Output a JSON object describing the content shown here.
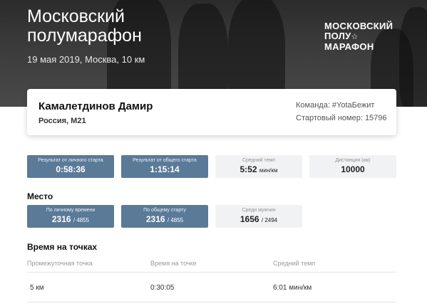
{
  "header": {
    "title_line1": "Московский",
    "title_line2": "полумарафон",
    "subtitle": "19 мая 2019, Москва, 10 км",
    "logo_line1": "МОСКОВСКИЙ",
    "logo_line2": "ПОЛУ",
    "logo_star": "☆",
    "logo_line3": "МАРАФОН"
  },
  "athlete": {
    "name": "Камалетдинов Дамир",
    "country_group": "Россия, М21",
    "team": "Команда: #YotaБежит",
    "bib": "Стартовый номер: 15796"
  },
  "stats": [
    {
      "label": "Результат от личного старта",
      "value": "0:58:36"
    },
    {
      "label": "Результат от общего старта",
      "value": "1:15:14"
    },
    {
      "label": "Средний темп",
      "value": "5:52",
      "unit": "мин/км"
    },
    {
      "label": "Дистанция (км)",
      "value": "10000"
    }
  ],
  "place": {
    "title": "Место",
    "items": [
      {
        "label": "По личному времени",
        "value": "2316",
        "total": "/ 4855"
      },
      {
        "label": "По общему старту",
        "value": "2316",
        "total": "/ 4855"
      },
      {
        "label": "Среди мужчин",
        "value": "1656",
        "total": "/ 2494"
      }
    ]
  },
  "splits": {
    "title": "Время на точках",
    "columns": [
      "Промежуточная точка",
      "Время на точке",
      "Средний темп"
    ],
    "rows": [
      {
        "point": "5 км",
        "time": "0:30:05",
        "pace": "6:01 мин/км"
      }
    ]
  }
}
